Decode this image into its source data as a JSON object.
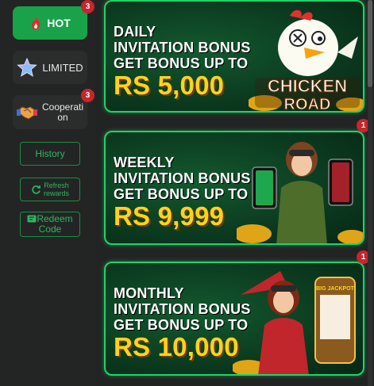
{
  "sidebar": {
    "categories": [
      {
        "label": "HOT",
        "badge": "3",
        "icon": "flame-icon",
        "active": true
      },
      {
        "label": "LIMITED",
        "badge": "",
        "icon": "star-icon",
        "active": false
      },
      {
        "label": "Cooperati on",
        "label_line1": "Cooperati",
        "label_line2": "on",
        "badge": "3",
        "icon": "handshake-icon",
        "active": false
      }
    ],
    "history_label": "History",
    "refresh_line1": "Refresh",
    "refresh_line2": "rewards",
    "redeem_line1": "Redeem",
    "redeem_line2": "Code"
  },
  "cards": [
    {
      "line1": "DAILY",
      "line2": "INVITATION BONUS",
      "line3": "GET BONUS UP TO",
      "amount": "RS 5,000",
      "badge": "",
      "art": "chicken-road-mascot"
    },
    {
      "line1": "WEEKLY",
      "line2": "INVITATION BONUS",
      "line3": "GET BONUS UP TO",
      "amount": "RS 9,999",
      "badge": "1",
      "art": "pilot-girl-with-phones"
    },
    {
      "line1": "MONTHLY",
      "line2": "INVITATION BONUS",
      "line3": "GET BONUS UP TO",
      "amount": "RS 10,000",
      "badge": "1",
      "art": "pilot-girl-with-slot-machine"
    }
  ],
  "art_text": {
    "chicken_logo_1": "CHICKEN",
    "chicken_logo_2": "ROAD",
    "jackpot": "BIG JACKPOT"
  },
  "colors": {
    "accent": "#19a24a",
    "card_border": "#1fd36a",
    "amount": "#ffd31a",
    "badge": "#c9252d"
  }
}
